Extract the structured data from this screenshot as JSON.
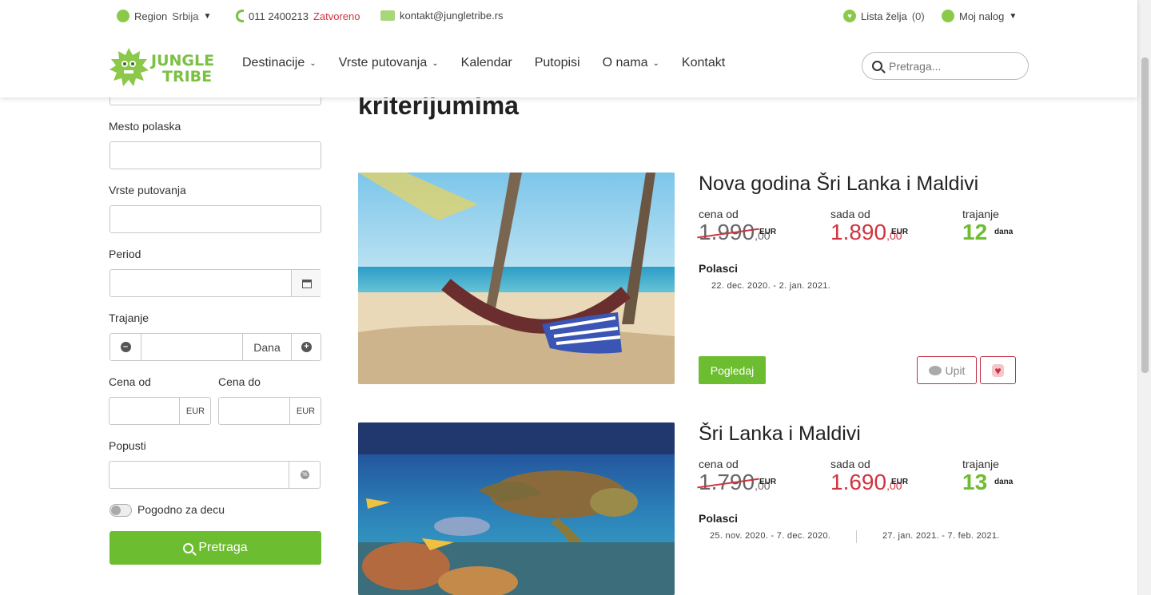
{
  "topbar": {
    "region_label": "Region",
    "region_value": "Srbija",
    "phone": "011 2400213",
    "phone_status": "Zatvoreno",
    "email": "kontakt@jungletribe.rs",
    "wishlist_label": "Lista želja",
    "wishlist_count": "(0)",
    "account_label": "Moj nalog"
  },
  "logo": {
    "line1": "JUNGLE",
    "line2": "TRIBE"
  },
  "nav": {
    "items": [
      {
        "label": "Destinacije",
        "dropdown": true
      },
      {
        "label": "Vrste putovanja",
        "dropdown": true
      },
      {
        "label": "Kalendar",
        "dropdown": false
      },
      {
        "label": "Putopisi",
        "dropdown": false
      },
      {
        "label": "O nama",
        "dropdown": true
      },
      {
        "label": "Kontakt",
        "dropdown": false
      }
    ]
  },
  "search": {
    "placeholder": "Pretraga..."
  },
  "filters": {
    "departure_label": "Mesto polaska",
    "type_label": "Vrste putovanja",
    "period_label": "Period",
    "duration_label": "Trajanje",
    "duration_unit": "Dana",
    "price_from_label": "Cena od",
    "price_to_label": "Cena do",
    "currency": "EUR",
    "discounts_label": "Popusti",
    "kids_label": "Pogodno za decu",
    "search_button": "Pretraga"
  },
  "main": {
    "heading": "kriterijumima"
  },
  "cards": [
    {
      "title": "Nova godina Šri Lanka i Maldivi",
      "price_from_label": "cena od",
      "old_price": "1.990",
      "old_price_dec": ",00",
      "now_label": "sada od",
      "new_price": "1.890",
      "new_price_dec": ",00",
      "currency": "EUR",
      "duration_label": "trajanje",
      "duration": "12",
      "duration_unit": "dana",
      "departures_label": "Polasci",
      "departures": [
        "22. dec. 2020. - 2. jan. 2021."
      ],
      "view_button": "Pogledaj",
      "inquiry_button": "Upit",
      "wishlist_icon": "heart-icon"
    },
    {
      "title": "Šri Lanka i Maldivi",
      "price_from_label": "cena od",
      "old_price": "1.790",
      "old_price_dec": ",00",
      "now_label": "sada od",
      "new_price": "1.690",
      "new_price_dec": ",00",
      "currency": "EUR",
      "duration_label": "trajanje",
      "duration": "13",
      "duration_unit": "dana",
      "departures_label": "Polasci",
      "departures": [
        "25. nov. 2020. - 7. dec. 2020.",
        "27. jan. 2021. - 7. feb. 2021."
      ]
    }
  ],
  "colors": {
    "brand_green": "#6cbd2f",
    "price_red": "#d0333f"
  }
}
